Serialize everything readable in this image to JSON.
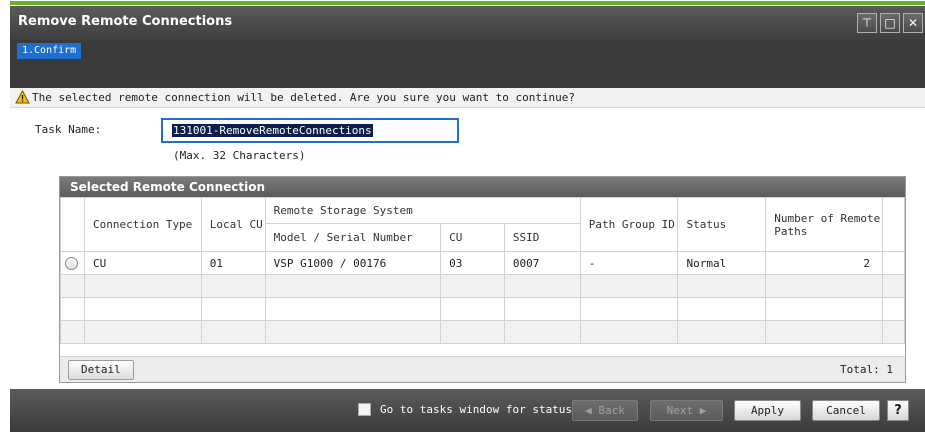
{
  "window": {
    "title": "Remove Remote Connections",
    "buttons": [
      "pin-icon",
      "maximize-icon",
      "close-icon"
    ]
  },
  "steps": [
    {
      "label": "1.Confirm"
    }
  ],
  "warning": {
    "icon": "warning-icon",
    "text": "The selected remote connection will be deleted. Are you sure you want to continue?"
  },
  "task": {
    "label": "Task Name:",
    "value": "131001-RemoveRemoteConnections",
    "hint": "(Max. 32 Characters)"
  },
  "panel": {
    "title": "Selected Remote Connection",
    "headers": {
      "connection_type": "Connection Type",
      "local_cu": "Local CU",
      "remote_storage_system": "Remote Storage System",
      "model_serial": "Model / Serial Number",
      "cu": "CU",
      "ssid": "SSID",
      "path_group_id": "Path Group ID",
      "status": "Status",
      "remote_paths": "Number of Remote Paths"
    },
    "rows": [
      {
        "connection_type": "CU",
        "local_cu": "01",
        "model_serial": "VSP G1000 / 00176",
        "cu": "03",
        "ssid": "0007",
        "path_group_id": "-",
        "status": "Normal",
        "remote_paths": "2"
      }
    ],
    "detail_label": "Detail",
    "total": "Total:  1"
  },
  "footer": {
    "goto_label": "Go to tasks window for status",
    "back_label": "◀ Back",
    "next_label": "Next ▶",
    "apply_label": "Apply",
    "cancel_label": "Cancel",
    "help_label": "?"
  },
  "colors": {
    "accent": "#1f6fd0",
    "top_line": "#6ab023"
  }
}
